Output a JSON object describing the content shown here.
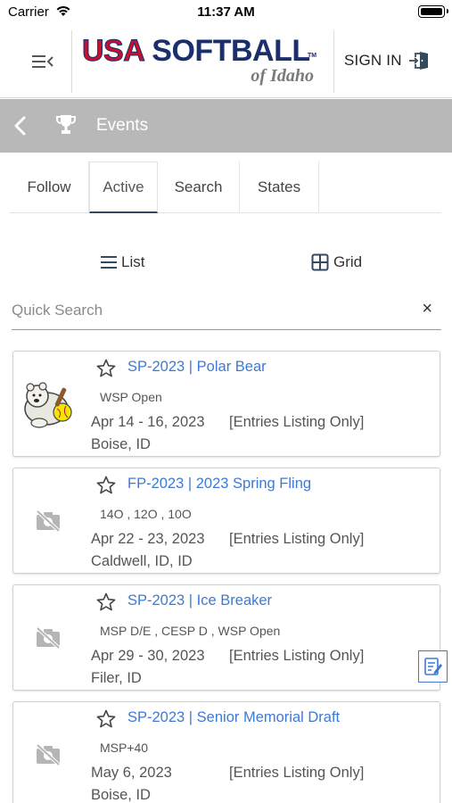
{
  "status_bar": {
    "carrier": "Carrier",
    "time": "11:37 AM"
  },
  "header": {
    "logo": {
      "word1": "USA",
      "word2": "SOFTBALL",
      "tm": "TM",
      "sub": "of Idaho"
    },
    "sign_in_label": "SIGN IN"
  },
  "events_bar": {
    "title": "Events"
  },
  "tabs": [
    {
      "label": "Follow"
    },
    {
      "label": "Active",
      "selected": true
    },
    {
      "label": "Search"
    },
    {
      "label": "States"
    }
  ],
  "view_toggle": {
    "list_label": "List",
    "grid_label": "Grid"
  },
  "search": {
    "placeholder": "Quick Search",
    "value": "",
    "clear_glyph": "×"
  },
  "events": [
    {
      "title": "SP-2023 | Polar Bear",
      "divisions": "WSP Open",
      "dates": "Apr 14 - 16, 2023",
      "note": "[Entries Listing Only]",
      "location": "Boise, ID",
      "image": "polar-bear-mascot"
    },
    {
      "title": "FP-2023 | 2023 Spring Fling",
      "divisions": "14O ,  12O ,  10O",
      "dates": "Apr 22 - 23, 2023",
      "note": "[Entries Listing Only]",
      "location": "Caldwell, ID, ID",
      "image": "no-image-icon"
    },
    {
      "title": "SP-2023 | Ice Breaker",
      "divisions": "MSP D/E ,  CESP D ,  WSP Open",
      "dates": "Apr 29 - 30, 2023",
      "note": "[Entries Listing Only]",
      "location": "Filer, ID",
      "image": "no-image-icon"
    },
    {
      "title": "SP-2023 | Senior Memorial Draft",
      "divisions": "MSP+40",
      "dates": "May 6, 2023",
      "note": "[Entries Listing Only]",
      "location": "Boise, ID",
      "image": "no-image-icon"
    }
  ],
  "colors": {
    "link": "#3d7ad6",
    "events_bar": "#b8b8b8",
    "logo_red": "#c8102e",
    "logo_navy": "#1a2f6b"
  }
}
